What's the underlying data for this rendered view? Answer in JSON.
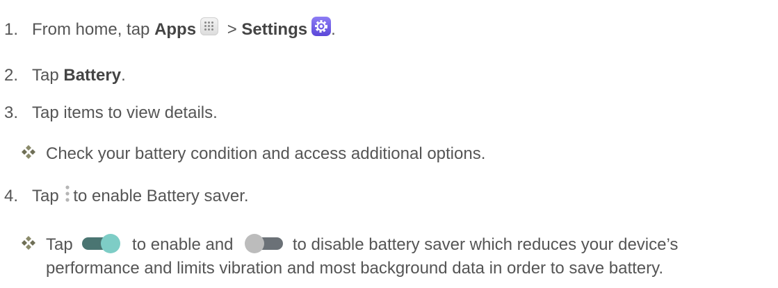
{
  "steps": [
    {
      "num": "1.",
      "pre": "From home, tap ",
      "b1": "Apps",
      "mid": " > ",
      "b2": "Settings",
      "post": "."
    },
    {
      "num": "2.",
      "pre": "Tap ",
      "b1": "Battery",
      "post": "."
    },
    {
      "num": "3.",
      "text": "Tap items to view details."
    },
    {
      "bullet": "Check your battery condition and access additional options."
    },
    {
      "num": "4.",
      "pre": "Tap ",
      "post": "to enable Battery saver."
    },
    {
      "pre": "Tap ",
      "mid": " to enable and ",
      "post": " to disable battery saver which reduces your device’s",
      "cont": "performance and limits vibration and most background data in order to save battery."
    }
  ],
  "icons": {
    "apps": "apps-icon",
    "settings": "settings-gear-icon",
    "bullet": "diamond-bullet-icon",
    "menu": "more-options-icon",
    "toggle_on": "toggle-on-icon",
    "toggle_off": "toggle-off-icon"
  },
  "colors": {
    "text": "#555555",
    "settings_purple": "#6a56e6",
    "toggle_on_track": "#4a7572",
    "toggle_on_knob": "#7ecdc6",
    "toggle_off_track": "#6b7177",
    "toggle_off_knob": "#bcbcbc",
    "bullet": "#8a8a6a"
  }
}
